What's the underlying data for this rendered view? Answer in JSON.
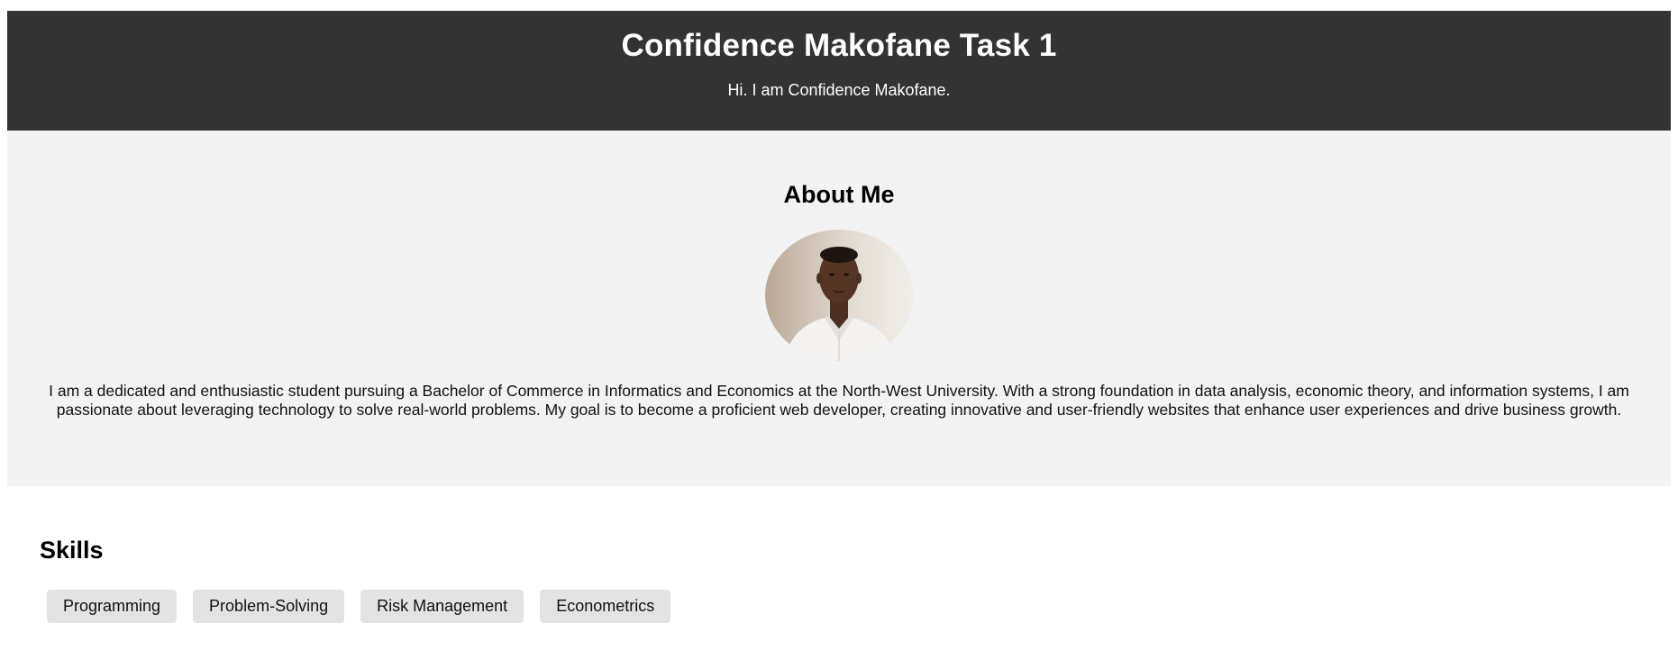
{
  "header": {
    "title": "Confidence Makofane Task 1",
    "subtitle": "Hi. I am Confidence Makofane."
  },
  "about": {
    "heading": "About Me",
    "photo_alt": "Confidence Makofane",
    "paragraph": "I am a dedicated and enthusiastic student pursuing a Bachelor of Commerce in Informatics and Economics at the North-West University. With a strong foundation in data analysis, economic theory, and information systems, I am passionate about leveraging technology to solve real-world problems. My goal is to become a proficient web developer, creating innovative and user-friendly websites that enhance user experiences and drive business growth."
  },
  "skills": {
    "heading": "Skills",
    "items": [
      "Programming",
      "Problem-Solving",
      "Risk Management",
      "Econometrics"
    ]
  },
  "colors": {
    "header_bg": "#333333",
    "about_bg": "#f3f3f3",
    "skill_bg": "#e3e3e3"
  }
}
